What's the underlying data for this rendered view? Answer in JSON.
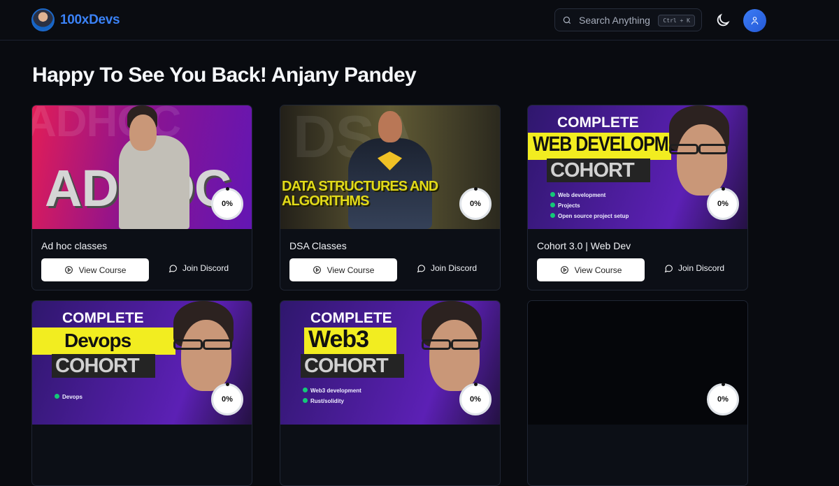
{
  "brand": {
    "name": "100xDevs"
  },
  "search": {
    "placeholder": "Search Anything",
    "shortcut": "Ctrl + K"
  },
  "greeting": "Happy To See You Back! Anjany Pandey",
  "courses": [
    {
      "title": "Ad hoc classes",
      "progress": "0%",
      "thumb_text": "ADHOC",
      "thumb_bg": "ADHOC"
    },
    {
      "title": "DSA Classes",
      "progress": "0%",
      "thumb_text": "DATA STRUCTURES AND ALGORITHMS",
      "thumb_bg": "DSA"
    },
    {
      "title": "Cohort 3.0 | Web Dev",
      "progress": "0%",
      "thumb_heading": "COMPLETE",
      "thumb_subject": "WEB DEVELOPMENT",
      "thumb_cohort": "COHORT",
      "features": [
        "Web development",
        "Projects",
        "Open source project setup"
      ]
    },
    {
      "progress": "0%",
      "thumb_heading": "COMPLETE",
      "thumb_subject": "Devops",
      "thumb_cohort": "COHORT",
      "features": [
        "Devops"
      ]
    },
    {
      "progress": "0%",
      "thumb_heading": "COMPLETE",
      "thumb_subject": "Web3",
      "thumb_cohort": "COHORT",
      "features": [
        "Web3 development",
        "Rust/solidity"
      ]
    },
    {
      "progress": "0%"
    }
  ],
  "buttons": {
    "view_course": "View Course",
    "join_discord": "Join Discord"
  },
  "colors": {
    "accent": "#3b82f6",
    "background": "#090b10"
  },
  "icons": {
    "search": "search-icon",
    "theme": "moon-icon",
    "profile": "user-icon",
    "view": "play-circle-icon",
    "discord": "message-circle-icon"
  }
}
